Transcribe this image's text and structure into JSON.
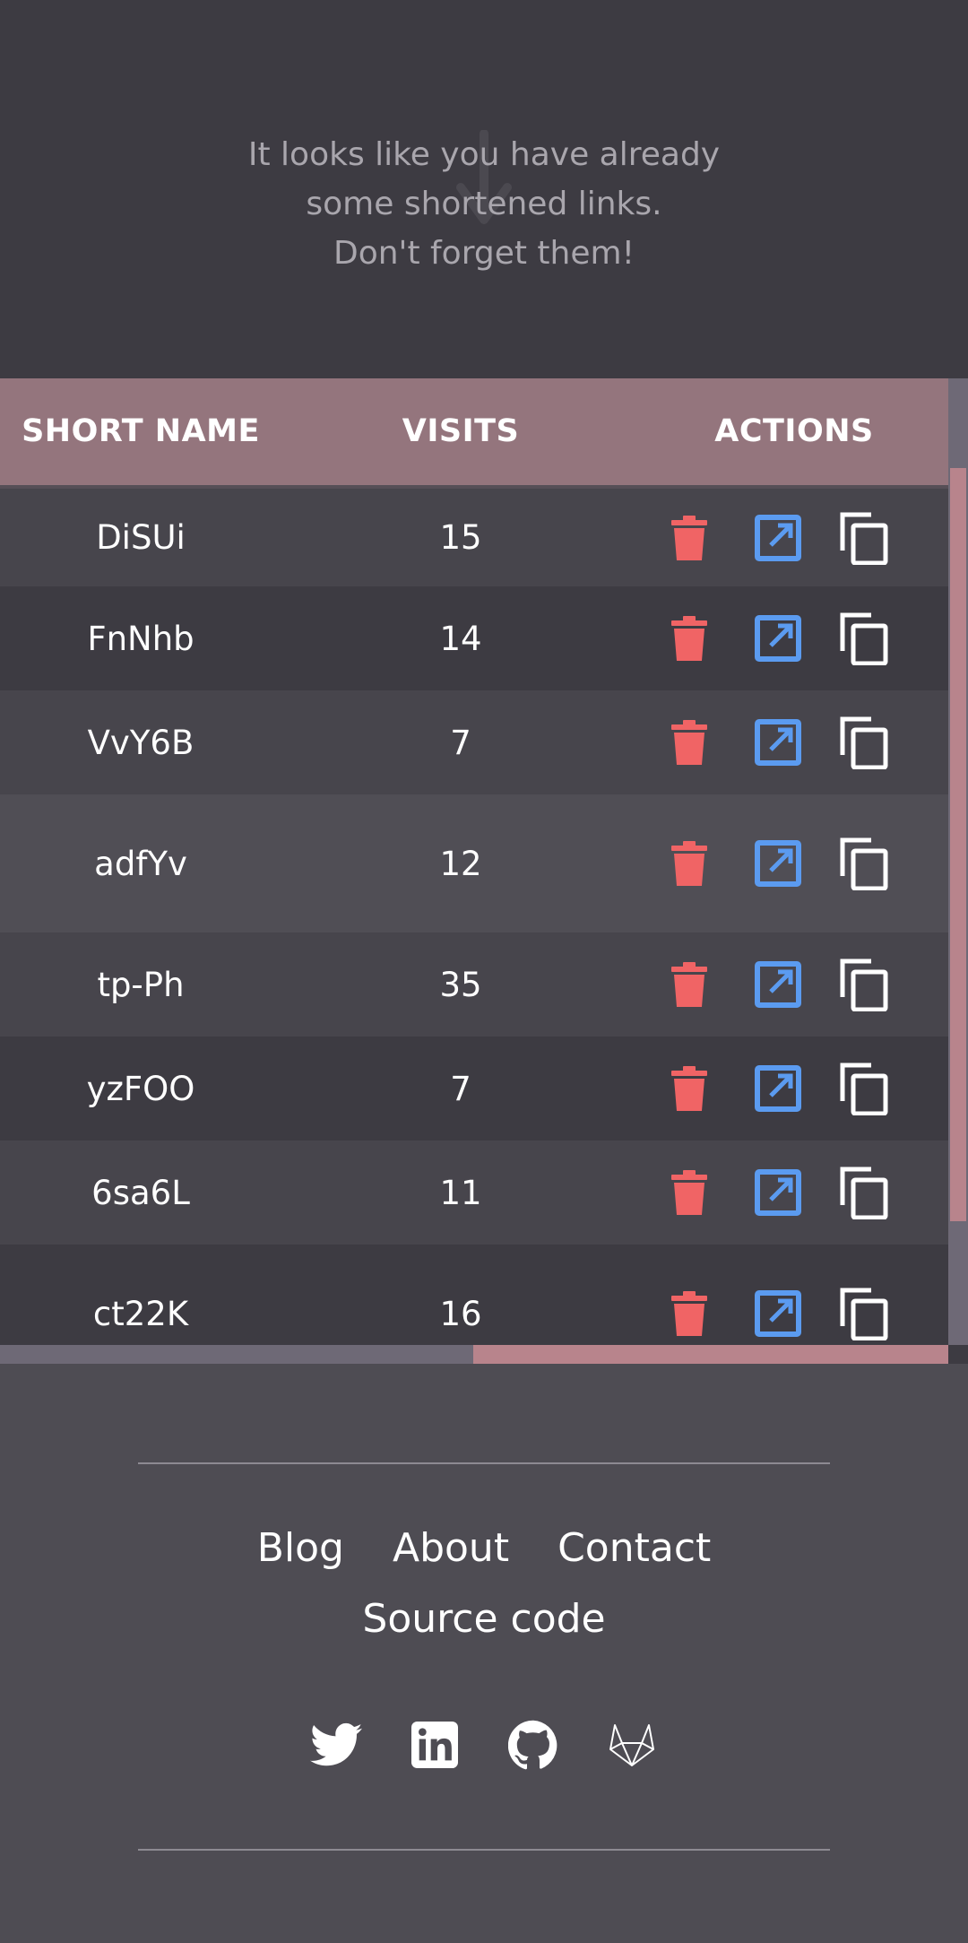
{
  "hero": {
    "line1": "It looks like you have already",
    "line2": "some shortened links.",
    "line3": "Don't forget them!"
  },
  "table": {
    "headers": {
      "name": "SHORT NAME",
      "visits": "VISITS",
      "actions": "ACTIONS"
    },
    "rows": [
      {
        "name": "DiSUi",
        "visits": "15"
      },
      {
        "name": "FnNhb",
        "visits": "14"
      },
      {
        "name": "VvY6B",
        "visits": "7"
      },
      {
        "name": "adfYv",
        "visits": "12"
      },
      {
        "name": "tp-Ph",
        "visits": "35"
      },
      {
        "name": "yzFOO",
        "visits": "7"
      },
      {
        "name": "6sa6L",
        "visits": "11"
      },
      {
        "name": "ct22K",
        "visits": "16"
      }
    ],
    "colors": {
      "header_bg": "#94757d",
      "delete": "#f06465",
      "open": "#5b9bf0",
      "copy": "#ffffff",
      "scroll_thumb": "#b8848c"
    },
    "icons": {
      "delete": "trash-icon",
      "open": "open-external-icon",
      "copy": "copy-icon"
    }
  },
  "footer": {
    "links": {
      "blog": "Blog",
      "about": "About",
      "contact": "Contact",
      "source": "Source code"
    },
    "socials": [
      "twitter-icon",
      "linkedin-icon",
      "github-icon",
      "gitlab-icon"
    ]
  }
}
